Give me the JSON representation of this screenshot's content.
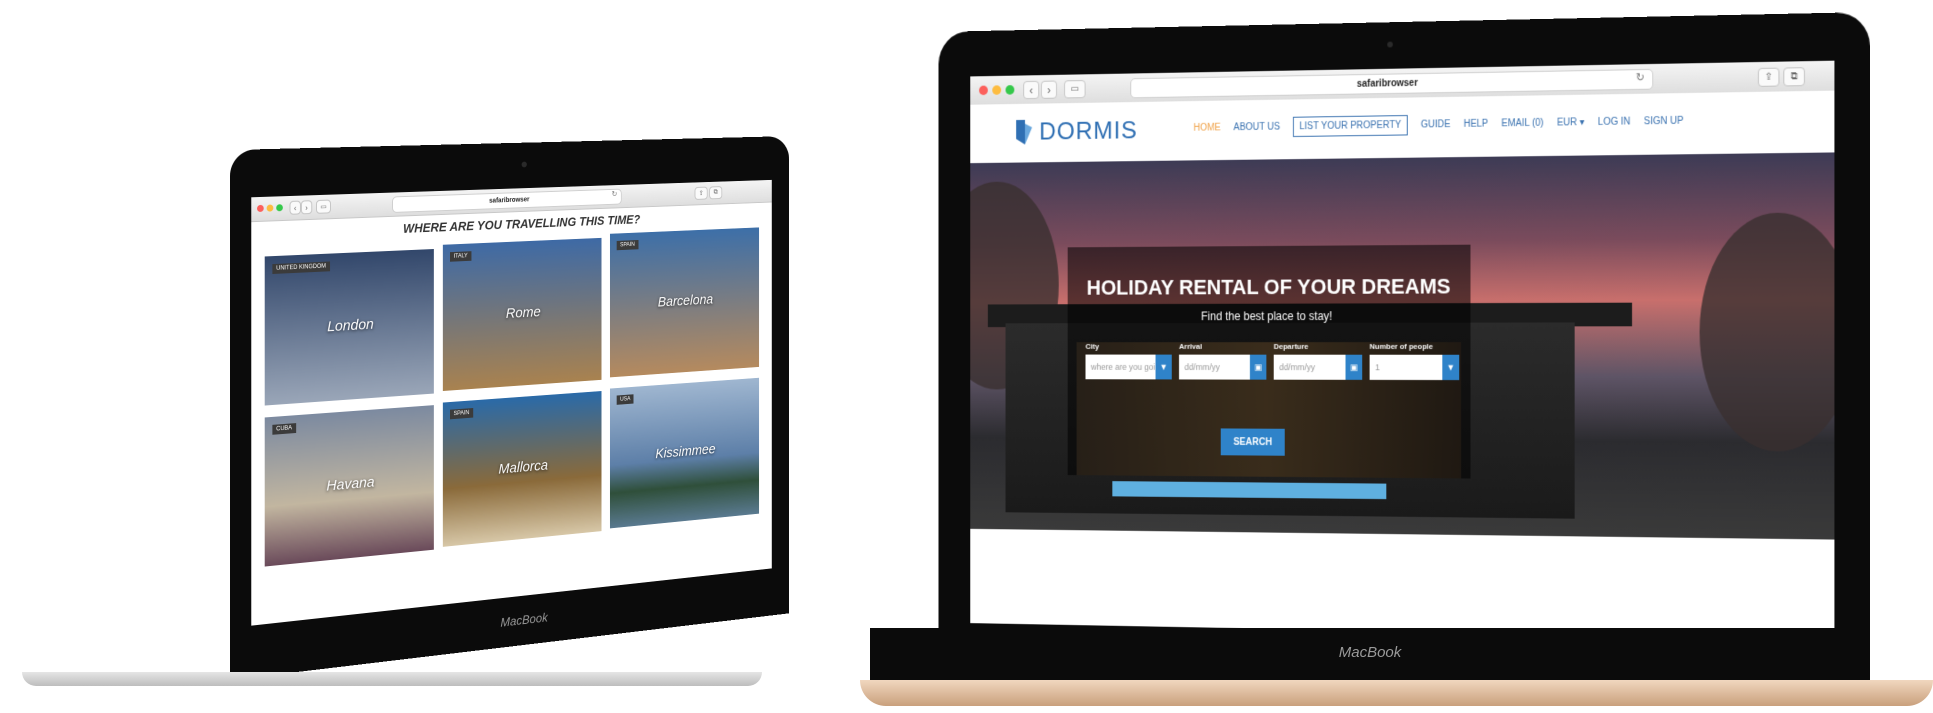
{
  "left_laptop": {
    "browser": {
      "url_label": "safaribrowser"
    },
    "page_title": "WHERE ARE YOU TRAVELLING THIS TIME?",
    "destinations": [
      {
        "country": "UNITED KINGDOM",
        "city": "London",
        "colors": [
          "#32476b",
          "#9aa6b8"
        ]
      },
      {
        "country": "ITALY",
        "city": "Rome",
        "colors": [
          "#5e4b34",
          "#a9824f"
        ]
      },
      {
        "country": "SPAIN",
        "city": "Barcelona",
        "colors": [
          "#3d5d86",
          "#b58a5e"
        ]
      },
      {
        "country": "CUBA",
        "city": "Havana",
        "colors": [
          "#5b6c82",
          "#c2b6a0"
        ]
      },
      {
        "country": "SPAIN",
        "city": "Mallorca",
        "colors": [
          "#2a6aa8",
          "#d7c7a7"
        ]
      },
      {
        "country": "USA",
        "city": "Kissimmee",
        "colors": [
          "#5d7fa8",
          "#2f4f3a"
        ]
      }
    ],
    "chin_label": "MacBook"
  },
  "right_laptop": {
    "browser": {
      "url_label": "safaribrowser"
    },
    "site": {
      "logo_text": "DORMIS",
      "nav": {
        "home": "HOME",
        "about": "ABOUT US",
        "list_property": "LIST YOUR PROPERTY",
        "guide": "GUIDE",
        "help": "HELP",
        "email": "EMAIL (0)",
        "currency": "EUR ▾",
        "login": "LOG IN",
        "signup": "SIGN UP"
      }
    },
    "hero": {
      "title": "HOLIDAY RENTAL OF YOUR DREAMS",
      "subtitle": "Find the best place to stay!",
      "city_label": "City",
      "city_placeholder": "where are you going?",
      "arrival_label": "Arrival",
      "arrival_placeholder": "dd/mm/yy",
      "departure_label": "Departure",
      "departure_placeholder": "dd/mm/yy",
      "people_label": "Number of people",
      "people_value": "1",
      "search_label": "SEARCH"
    },
    "chin_label": "MacBook"
  },
  "colors": {
    "brand_blue": "#2f83c9",
    "nav_blue": "#3a72b0",
    "nav_active": "#f0a34a"
  }
}
